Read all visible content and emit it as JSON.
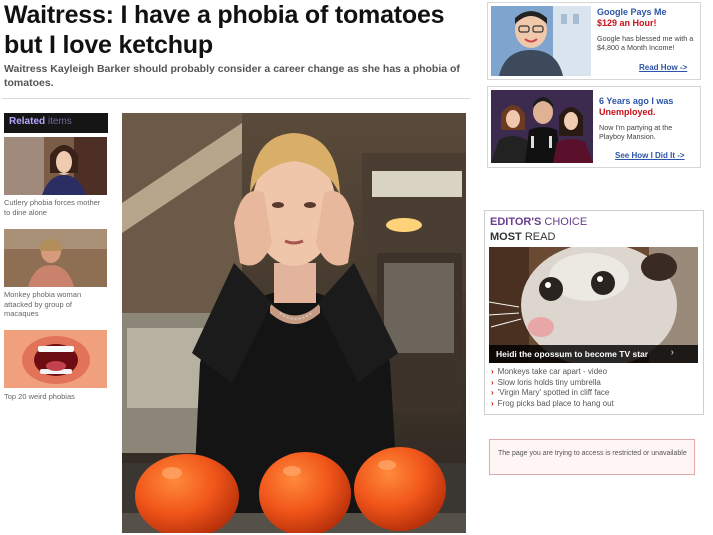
{
  "article": {
    "headline_line1": "Waitress: I have a phobia of tomatoes",
    "headline_line2": "but I love ketchup",
    "standfirst": "Waitress Kayleigh Barker should probably consider a career change as she has a phobia of tomatoes."
  },
  "related": {
    "label_bold": "Related",
    "label_rest": "items",
    "items": [
      {
        "caption": "Cutlery phobia forces mother to dine alone"
      },
      {
        "caption": "Monkey phobia woman attacked by group of macaques"
      },
      {
        "caption": "Top 20 weird phobias"
      }
    ]
  },
  "ads": [
    {
      "title1": "Google Pays Me",
      "title2": "$129 an Hour!",
      "text": "Google has blessed me with a $4,800 a Month Income!",
      "link": "Read How ->"
    },
    {
      "title1": "6 Years ago I was",
      "title2": "Unemployed.",
      "text": "Now I'm partying at the Playboy Mansion.",
      "link": "See How I Did It ->"
    }
  ],
  "editors": {
    "label_editors": "EDITOR'S",
    "label_choice": "CHOICE",
    "label_most": "MOST",
    "label_read": "READ",
    "feature_caption": "Heidi the opossum to become TV star",
    "list": [
      "Monkeys take car apart - video",
      "Slow loris holds tiny umbrella",
      "'Virgin Mary' spotted in cliff face",
      "Frog picks bad place to hang out"
    ]
  },
  "notice": {
    "text": "The page you are trying to access is restricted or unavailable"
  },
  "colors": {
    "link_blue": "#2b55a6",
    "ad_red": "#c8101a",
    "editors_purple": "#6a3d8e"
  }
}
